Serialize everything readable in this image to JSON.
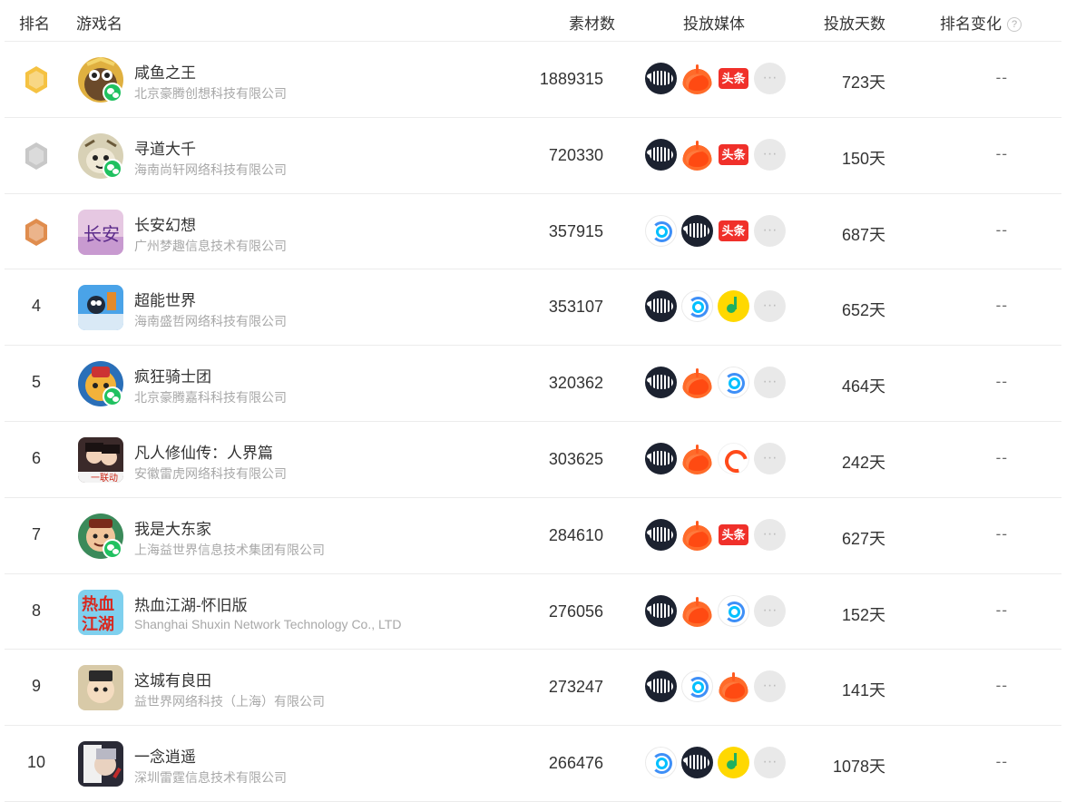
{
  "header": {
    "rank": "排名",
    "game": "游戏名",
    "count": "素材数",
    "media": "投放媒体",
    "days": "投放天数",
    "change": "排名变化",
    "help": "?"
  },
  "colors": {
    "gold": "#f5c242",
    "silver": "#c8c8c8",
    "bronze": "#e08d4e",
    "wechat": "#20c160"
  },
  "rows": [
    {
      "rank": "1",
      "medal": "gold",
      "title": "咸鱼之王",
      "company": "北京豪腾创想科技有限公司",
      "count": "1889315",
      "days": "723天",
      "change": "--",
      "wechat": true,
      "media": [
        "pangle",
        "kuaishou",
        "toutiao",
        "more"
      ],
      "icon": "fish-king"
    },
    {
      "rank": "2",
      "medal": "silver",
      "title": "寻道大千",
      "company": "海南尚轩网络科技有限公司",
      "count": "720330",
      "days": "150天",
      "change": "--",
      "wechat": true,
      "media": [
        "pangle",
        "kuaishou",
        "toutiao",
        "more"
      ],
      "icon": "dao"
    },
    {
      "rank": "3",
      "medal": "bronze",
      "title": "长安幻想",
      "company": "广州梦趣信息技术有限公司",
      "count": "357915",
      "days": "687天",
      "change": "--",
      "wechat": false,
      "media": [
        "tencent",
        "pangle",
        "toutiao",
        "more"
      ],
      "icon": "changan"
    },
    {
      "rank": "4",
      "medal": "",
      "title": "超能世界",
      "company": "海南盛哲网络科技有限公司",
      "count": "353107",
      "days": "652天",
      "change": "--",
      "wechat": false,
      "media": [
        "pangle",
        "tencent",
        "qqmusic",
        "more"
      ],
      "icon": "chaoneng"
    },
    {
      "rank": "5",
      "medal": "",
      "title": "疯狂骑士团",
      "company": "北京豪腾嘉科科技有限公司",
      "count": "320362",
      "days": "464天",
      "change": "--",
      "wechat": true,
      "media": [
        "pangle",
        "kuaishou",
        "tencent",
        "more"
      ],
      "icon": "knight"
    },
    {
      "rank": "6",
      "medal": "",
      "title": "凡人修仙传：人界篇",
      "company": "安徽雷虎网络科技有限公司",
      "count": "303625",
      "days": "242天",
      "change": "--",
      "wechat": false,
      "media": [
        "pangle",
        "kuaishou",
        "vivo",
        "more"
      ],
      "icon": "fanren"
    },
    {
      "rank": "7",
      "medal": "",
      "title": "我是大东家",
      "company": "上海益世界信息技术集团有限公司",
      "count": "284610",
      "days": "627天",
      "change": "--",
      "wechat": true,
      "media": [
        "pangle",
        "kuaishou",
        "toutiao",
        "more"
      ],
      "icon": "dongjia"
    },
    {
      "rank": "8",
      "medal": "",
      "title": "热血江湖-怀旧版",
      "company": "Shanghai Shuxin Network Technology Co., LTD",
      "count": "276056",
      "days": "152天",
      "change": "--",
      "wechat": false,
      "media": [
        "pangle",
        "kuaishou",
        "tencent",
        "more"
      ],
      "icon": "jianghu"
    },
    {
      "rank": "9",
      "medal": "",
      "title": "这城有良田",
      "company": "益世界网络科技（上海）有限公司",
      "count": "273247",
      "days": "141天",
      "change": "--",
      "wechat": false,
      "media": [
        "pangle",
        "tencent",
        "kuaishou",
        "more"
      ],
      "icon": "liangtian"
    },
    {
      "rank": "10",
      "medal": "",
      "title": "一念逍遥",
      "company": "深圳雷霆信息技术有限公司",
      "count": "266476",
      "days": "1078天",
      "change": "--",
      "wechat": false,
      "media": [
        "tencent",
        "pangle",
        "qqmusic",
        "more"
      ],
      "icon": "yinian"
    }
  ]
}
